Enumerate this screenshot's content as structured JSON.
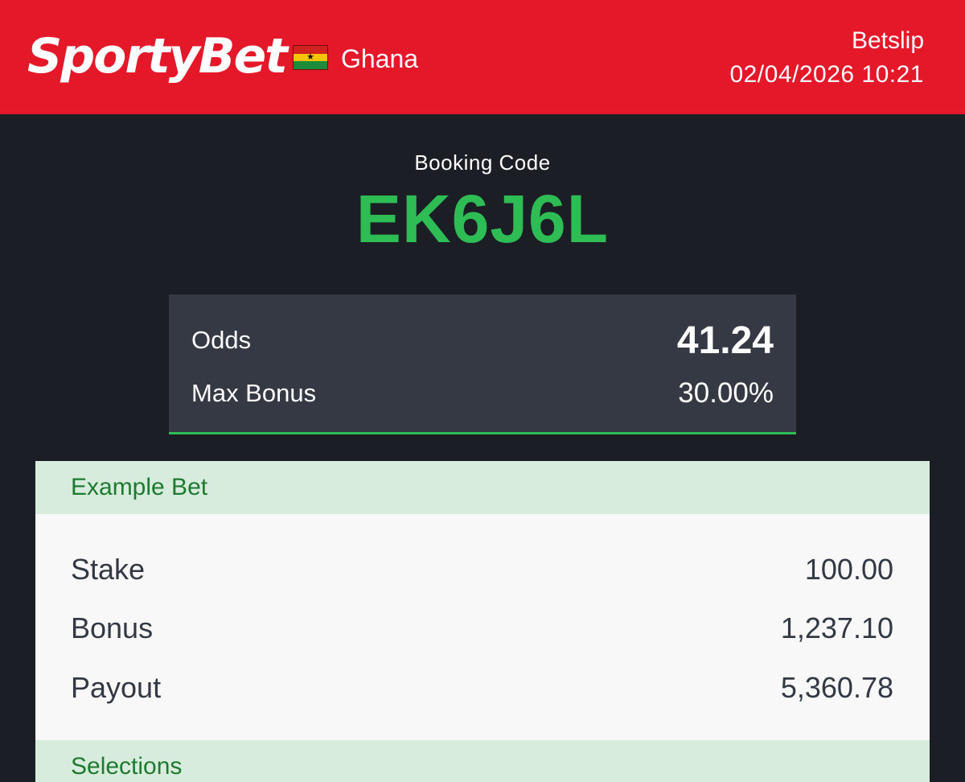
{
  "header": {
    "brand": "SportyBet",
    "country": "Ghana",
    "title": "Betslip",
    "timestamp": "02/04/2026 10:21",
    "flag_icon": "ghana-flag-icon",
    "colors": {
      "header_bg": "#e41829"
    }
  },
  "booking": {
    "label": "Booking Code",
    "code": "EK6J6L",
    "colors": {
      "code": "#2ebc55"
    }
  },
  "odds_box": {
    "odds_label": "Odds",
    "odds_value": "41.24",
    "max_bonus_label": "Max Bonus",
    "max_bonus_value": "30.00%"
  },
  "example_bet": {
    "title": "Example Bet",
    "rows": [
      {
        "label": "Stake",
        "value": "100.00"
      },
      {
        "label": "Bonus",
        "value": "1,237.10"
      },
      {
        "label": "Payout",
        "value": "5,360.78"
      }
    ]
  },
  "selections": {
    "title": "Selections"
  }
}
